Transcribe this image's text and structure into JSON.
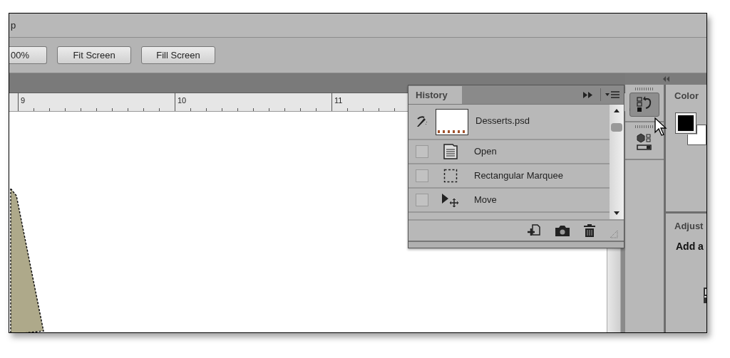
{
  "menu_bar": {
    "text": "p"
  },
  "options_bar": {
    "buttons": [
      "00%",
      "Fit Screen",
      "Fill Screen"
    ]
  },
  "ruler": {
    "labels": [
      "9",
      "10",
      "11"
    ]
  },
  "history_panel": {
    "tab": "History",
    "snapshot": {
      "label": "Desserts.psd"
    },
    "states": [
      {
        "kind": "open",
        "label": "Open",
        "checked": false
      },
      {
        "kind": "marquee",
        "label": "Rectangular Marquee",
        "checked": false
      },
      {
        "kind": "move",
        "label": "Move",
        "checked": false
      }
    ]
  },
  "dock": {
    "buttons": [
      {
        "kind": "history",
        "selected": true
      },
      {
        "kind": "properties",
        "selected": false
      }
    ]
  },
  "color_panel": {
    "title": "Color"
  },
  "adjustments_panel": {
    "title": "Adjust",
    "text": "Add a"
  }
}
